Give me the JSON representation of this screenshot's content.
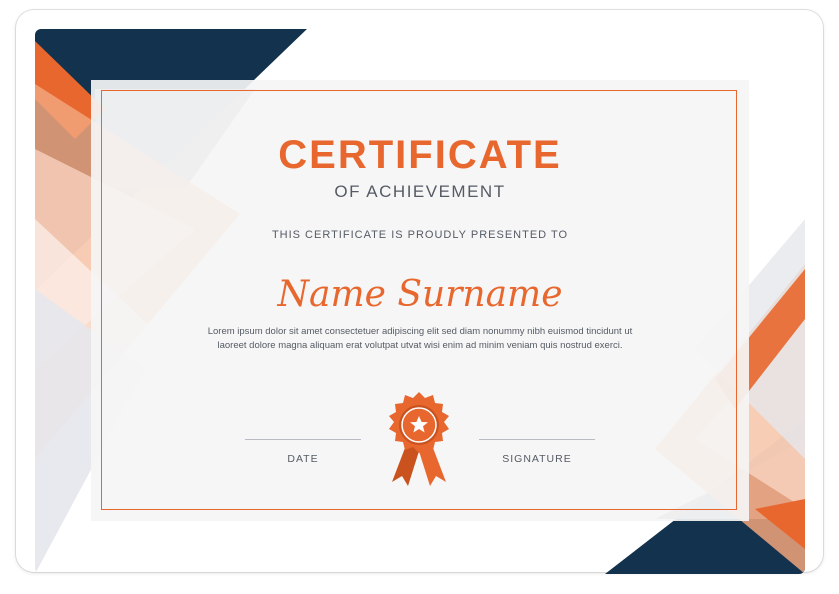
{
  "certificate": {
    "title": "CERTIFICATE",
    "subtitle": "OF ACHIEVEMENT",
    "presented_to": "THIS CERTIFICATE IS PROUDLY PRESENTED TO",
    "recipient_name": "Name Surname",
    "description": "Lorem ipsum dolor sit amet consectetuer adipiscing elit sed diam nonummy nibh euismod tincidunt ut laoreet dolore magna aliquam erat volutpat utvat wisi enim ad minim veniam quis nostrud exerci.",
    "date_label": "DATE",
    "signature_label": "SIGNATURE"
  },
  "colors": {
    "accent": "#e8672e",
    "navy": "#12324d",
    "peach": "#f2a47b",
    "text": "#555b64"
  },
  "icons": {
    "badge": "award-ribbon-star-icon"
  }
}
